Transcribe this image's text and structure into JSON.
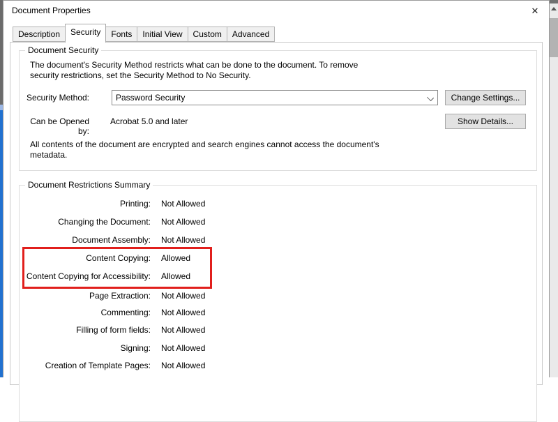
{
  "window": {
    "title": "Document Properties",
    "close_glyph": "✕"
  },
  "tabs": [
    {
      "label": "Description",
      "active": false
    },
    {
      "label": "Security",
      "active": true
    },
    {
      "label": "Fonts",
      "active": false
    },
    {
      "label": "Initial View",
      "active": false
    },
    {
      "label": "Custom",
      "active": false
    },
    {
      "label": "Advanced",
      "active": false
    }
  ],
  "document_security": {
    "legend": "Document Security",
    "intro_line1": "The document's Security Method restricts what can be done to the document. To remove",
    "intro_line2": "security restrictions, set the Security Method to No Security.",
    "security_method_label": "Security Method:",
    "security_method_value": "Password Security",
    "change_settings_button": "Change Settings...",
    "can_be_opened_by_label": "Can be Opened by:",
    "can_be_opened_by_value": "Acrobat 5.0 and later",
    "show_details_button": "Show Details...",
    "metadata_note_line1": "All contents of the document are encrypted and search engines cannot access the document's",
    "metadata_note_line2": "metadata."
  },
  "restrictions": {
    "legend": "Document Restrictions Summary",
    "rows": [
      {
        "label": "Printing:",
        "value": "Not Allowed"
      },
      {
        "label": "Changing the Document:",
        "value": "Not Allowed"
      },
      {
        "label": "Document Assembly:",
        "value": "Not Allowed"
      },
      {
        "label": "Content Copying:",
        "value": "Allowed"
      },
      {
        "label": "Content Copying for Accessibility:",
        "value": "Allowed"
      },
      {
        "label": "Page Extraction:",
        "value": "Not Allowed"
      },
      {
        "label": "Commenting:",
        "value": "Not Allowed"
      },
      {
        "label": "Filling of form fields:",
        "value": "Not Allowed"
      },
      {
        "label": "Signing:",
        "value": "Not Allowed"
      },
      {
        "label": "Creation of Template Pages:",
        "value": "Not Allowed"
      }
    ]
  },
  "colors": {
    "highlight_red": "#e11f1c",
    "accent_blue_edge": "#2171cf"
  }
}
